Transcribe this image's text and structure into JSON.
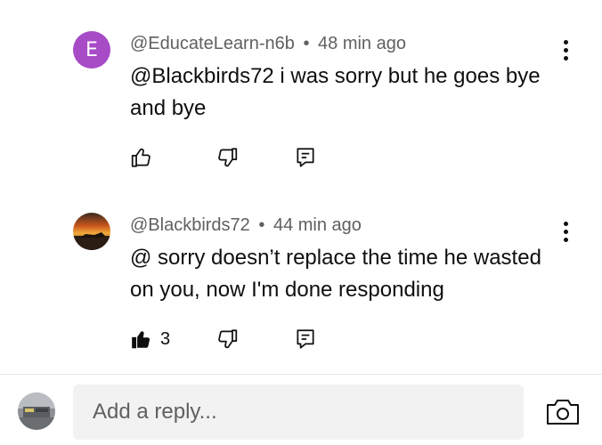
{
  "comments": [
    {
      "avatar_letter": "E",
      "avatar_color": "#a74bc7",
      "author": "@EducateLearn-n6b",
      "separator": "•",
      "time": "48 min ago",
      "text_line1": "@Blackbirds72  i was sorry but he goes bye",
      "text_line2": "and bye",
      "like_icon": "thumbs-up-outline-icon",
      "dislike_icon": "thumbs-down-outline-icon",
      "reply_icon": "reply-comment-icon",
      "menu_icon": "more-vert-icon"
    },
    {
      "avatar_icon": "sunset-photo-avatar",
      "author": "@Blackbirds72",
      "separator": "•",
      "time": "44 min ago",
      "text_line1": "@ sorry doesn’t replace the time he wasted",
      "text_line2": "on you, now I'm done responding",
      "like_count": "3",
      "like_icon": "thumbs-up-filled-icon",
      "dislike_icon": "thumbs-down-outline-icon",
      "reply_icon": "reply-comment-icon",
      "menu_icon": "more-vert-icon"
    }
  ],
  "reply_bar": {
    "placeholder": "Add a reply...",
    "avatar_icon": "train-photo-avatar",
    "camera_icon": "camera-icon"
  }
}
